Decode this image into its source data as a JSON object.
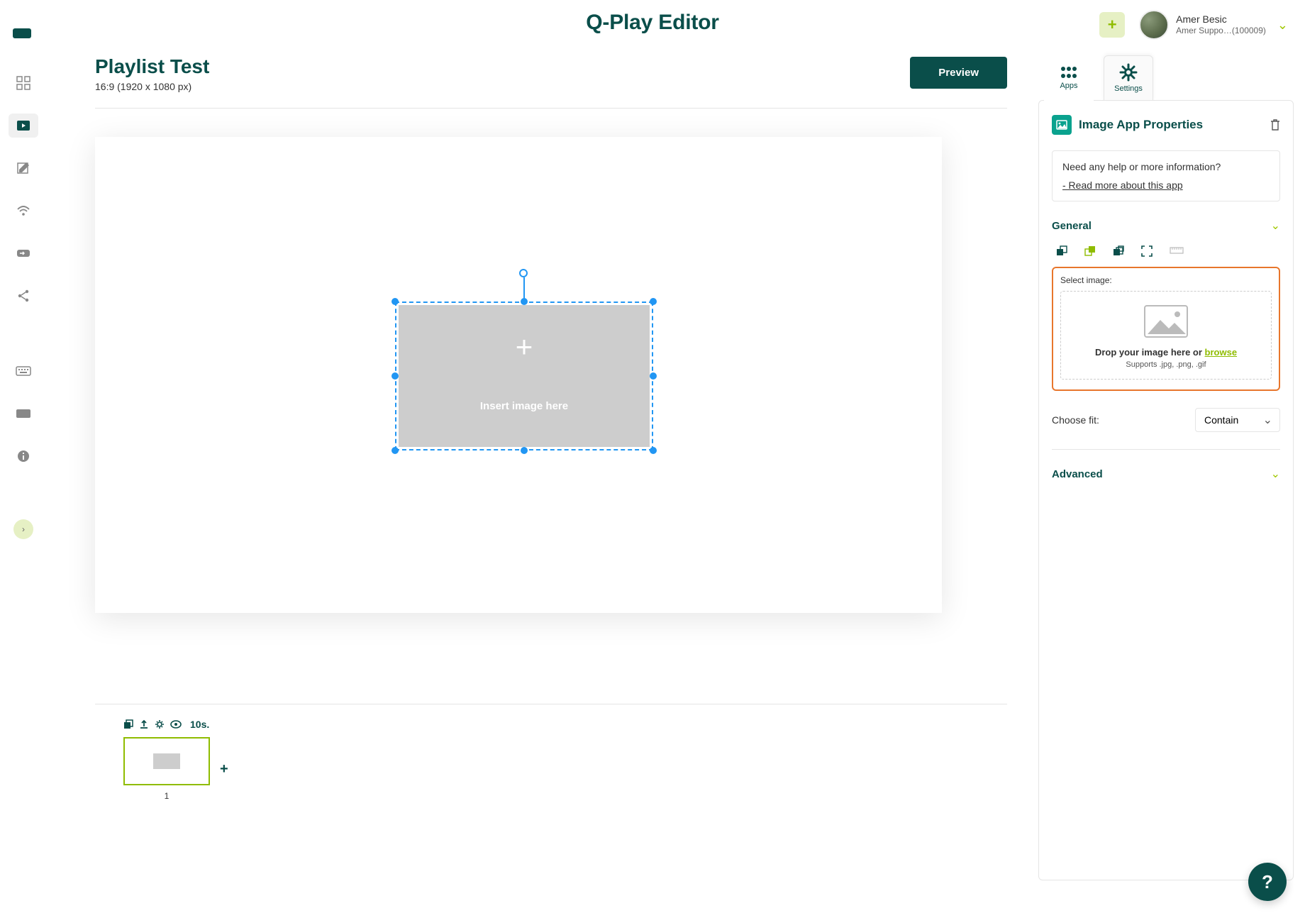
{
  "app": {
    "title": "Q-Play Editor"
  },
  "user": {
    "name": "Amer Besic",
    "sub": "Amer Suppo…(100009)"
  },
  "sidebar": {
    "items": [
      {
        "icon": "dashboard-icon"
      },
      {
        "icon": "media-icon"
      },
      {
        "icon": "edit-icon"
      },
      {
        "icon": "wifi-icon"
      },
      {
        "icon": "swap-icon"
      },
      {
        "icon": "share-icon"
      },
      {
        "icon": "keyboard-icon"
      },
      {
        "icon": "card-icon"
      },
      {
        "icon": "info-icon"
      }
    ]
  },
  "playlist": {
    "title": "Playlist Test",
    "sub": "16:9 (1920 x 1080 px)",
    "preview_label": "Preview"
  },
  "canvas": {
    "insert_plus": "+",
    "insert_label": "Insert image here"
  },
  "timeline": {
    "duration": "10s.",
    "slide_index": "1"
  },
  "right": {
    "tabs": {
      "apps": "Apps",
      "settings": "Settings"
    },
    "properties_title": "Image App Properties",
    "help_q": "Need any help or more information?",
    "help_link": "- Read more about this app",
    "section_general": "General",
    "section_advanced": "Advanced",
    "select_image_label": "Select image:",
    "dropzone_text_a": "Drop your image here or ",
    "dropzone_browse": "browse",
    "dropzone_sub": "Supports .jpg, .png, .gif",
    "fit_label": "Choose fit:",
    "fit_value": "Contain"
  }
}
